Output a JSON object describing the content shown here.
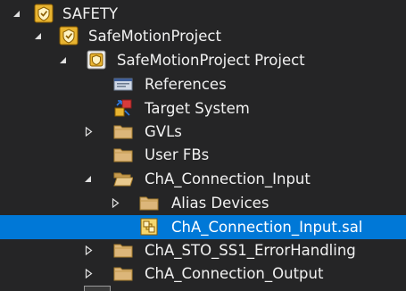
{
  "tree": {
    "items": [
      {
        "label": "SAFETY",
        "arrow": "expanded",
        "icon": "safety-project-icon"
      },
      {
        "label": "SafeMotionProject",
        "arrow": "expanded",
        "icon": "safety-project-icon"
      },
      {
        "label": "SafeMotionProject Project",
        "arrow": "expanded",
        "icon": "safety-project-icon"
      },
      {
        "label": "References",
        "arrow": "none",
        "icon": "references-icon"
      },
      {
        "label": "Target System",
        "arrow": "none",
        "icon": "target-system-icon"
      },
      {
        "label": "GVLs",
        "arrow": "collapsed",
        "icon": "folder-icon"
      },
      {
        "label": "User FBs",
        "arrow": "none",
        "icon": "folder-icon"
      },
      {
        "label": "ChA_Connection_Input",
        "arrow": "expanded",
        "icon": "folder-open-icon"
      },
      {
        "label": "Alias Devices",
        "arrow": "collapsed",
        "icon": "folder-icon"
      },
      {
        "label": "ChA_Connection_Input.sal",
        "arrow": "none",
        "icon": "sal-file-icon",
        "selected": true
      },
      {
        "label": "ChA_STO_SS1_ErrorHandling",
        "arrow": "collapsed",
        "icon": "folder-icon"
      },
      {
        "label": "ChA_Connection_Output",
        "arrow": "collapsed",
        "icon": "folder-icon"
      }
    ]
  },
  "colors": {
    "background": "#252526",
    "selection": "#0078d7",
    "text": "#f1f1f1",
    "folder": "#dcb67a",
    "safety_icon": "#e8b431"
  }
}
